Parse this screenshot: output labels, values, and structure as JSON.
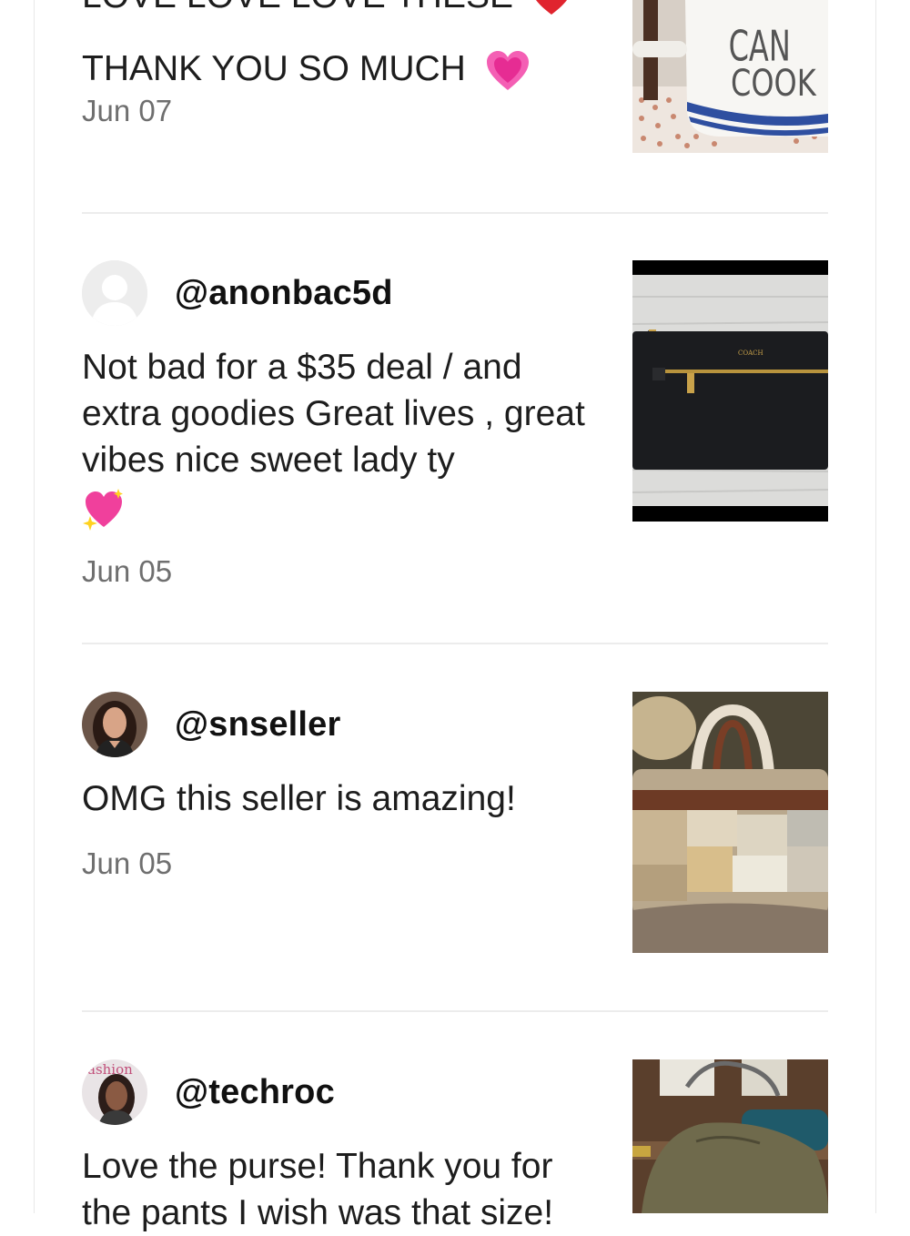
{
  "reviews": [
    {
      "username": "",
      "text_line1": "LOVE LOVE LOVE THESE",
      "text_line2": "THANK YOU SO MUCH",
      "emoji_1": "red-heart",
      "emoji_2": "growing-heart",
      "date": "Jun 07",
      "image_text_1": "CAN",
      "image_text_2": "COOK"
    },
    {
      "username": "@anonbac5d",
      "text": "Not bad for a $35 deal / and extra goodies Great lives , great vibes nice sweet lady ty",
      "emoji": "sparkling-heart",
      "date": "Jun 05",
      "image_text": "COACH"
    },
    {
      "username": "@snseller",
      "text": "OMG this seller is amazing!",
      "date": "Jun 05"
    },
    {
      "username": "@techroc",
      "text": "Love the purse! Thank you for the pants I wish was that size!",
      "avatar_text": "ashion"
    }
  ],
  "colors": {
    "divider": "#ececec",
    "date": "#6f6f6f",
    "text": "#1d1d1d"
  }
}
